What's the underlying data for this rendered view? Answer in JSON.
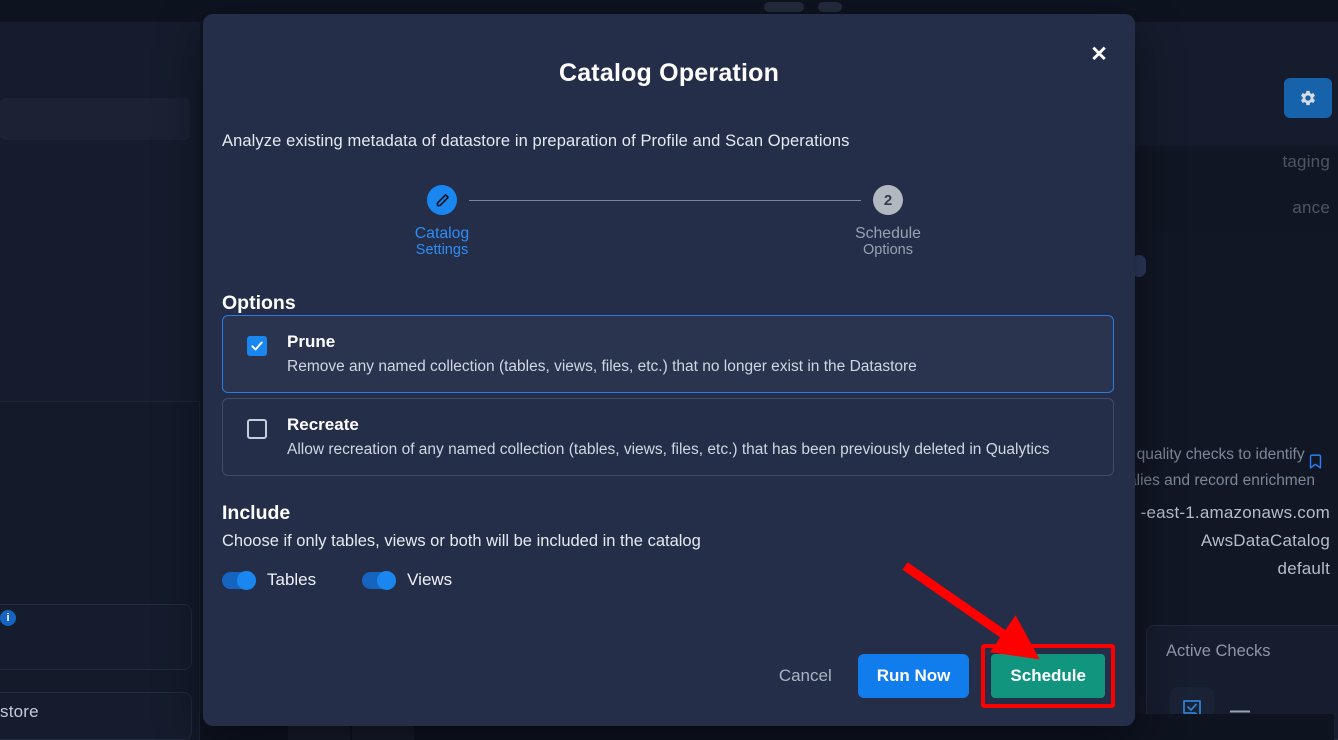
{
  "background": {
    "refresh_icon": "refresh-icon",
    "warning_badge": "!",
    "nav_items": [
      {
        "label": "taging"
      },
      {
        "label": "ance"
      }
    ],
    "bookmark_icon": "bookmark-icon",
    "datastore_lines": [
      "-east-1.amazonaws.com",
      "AwsDataCatalog",
      "default"
    ],
    "info_icon": "i",
    "database_icon": "database-export-icon",
    "add_datastore_label": "store",
    "add_icon": "+",
    "gear_icon": "gear-icon",
    "right_paragraph": [
      "t quality checks to identify",
      "alies and record enrichmen"
    ],
    "active_checks": {
      "title": "Active Checks",
      "icon": "check-note-icon",
      "value": "—"
    }
  },
  "modal": {
    "close_icon": "✕",
    "title": "Catalog Operation",
    "subtitle": "Analyze existing metadata of datastore in preparation of Profile and Scan Operations",
    "stepper": {
      "steps": [
        {
          "marker": "pencil-icon",
          "state": "active",
          "line1": "Catalog",
          "line2": "Settings"
        },
        {
          "marker": "2",
          "state": "inactive",
          "line1": "Schedule",
          "line2": "Options"
        }
      ]
    },
    "options": {
      "heading": "Options",
      "items": [
        {
          "title": "Prune",
          "description": "Remove any named collection (tables, views, files, etc.) that no longer exist in the Datastore",
          "checked": true
        },
        {
          "title": "Recreate",
          "description": "Allow recreation of any named collection (tables, views, files, etc.) that has been previously deleted in Qualytics",
          "checked": false
        }
      ]
    },
    "include": {
      "heading": "Include",
      "description": "Choose if only tables, views or both will be included in the catalog",
      "toggles": [
        {
          "label": "Tables",
          "on": true
        },
        {
          "label": "Views",
          "on": true
        }
      ]
    },
    "footer": {
      "cancel_label": "Cancel",
      "run_now_label": "Run Now",
      "schedule_label": "Schedule"
    }
  },
  "annotation": {
    "arrow_color": "#ff0000",
    "highlight_color": "#ff0000",
    "target": "Schedule"
  },
  "colors": {
    "page_bg": "#111725",
    "modal_bg": "#252e49",
    "accent_blue": "#1a86f0",
    "primary_button": "#117ceb",
    "schedule_button": "#12957f",
    "warning": "#c8952a",
    "selected_border": "#2a7ae0"
  }
}
